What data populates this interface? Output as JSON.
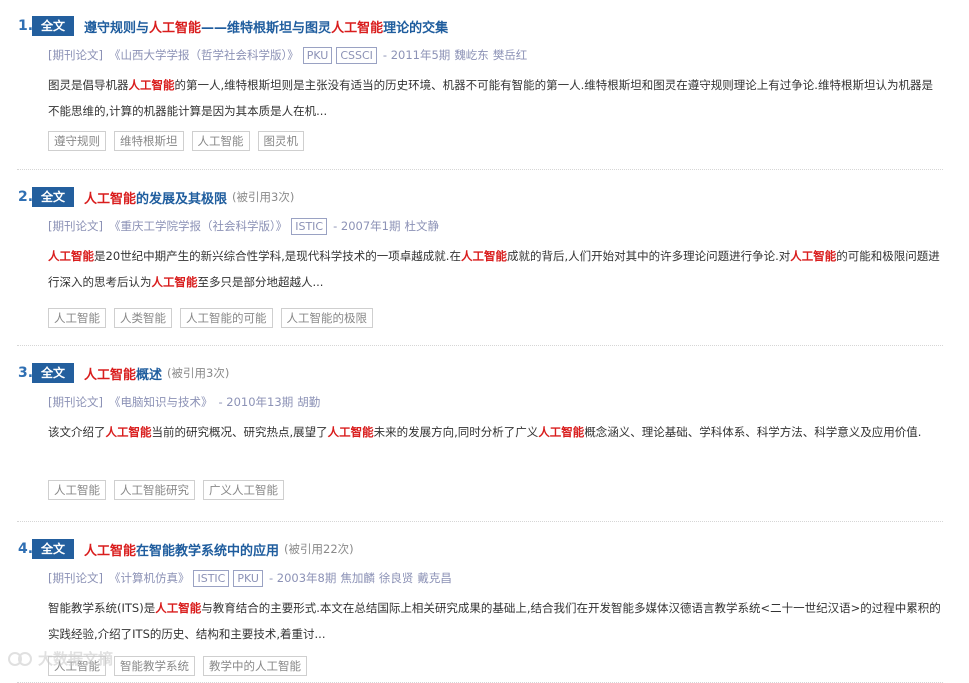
{
  "fulltext_label": "全文",
  "results": [
    {
      "num": "1.",
      "title_parts": [
        {
          "text": "遵守规则与",
          "hl": false
        },
        {
          "text": "人工智能",
          "hl": true
        },
        {
          "text": "——维特根斯坦与图灵",
          "hl": false
        },
        {
          "text": "人工智能",
          "hl": true
        },
        {
          "text": "理论的交集",
          "hl": false
        }
      ],
      "cite": "",
      "type": "[期刊论文]",
      "journal": "《山西大学学报（哲学社会科学版）》",
      "badges": [
        "PKU",
        "CSSCI"
      ],
      "issue": "- 2011年5期",
      "authors": [
        "魏屹东",
        "樊岳红"
      ],
      "snippet_parts": [
        {
          "text": "图灵是倡导机器",
          "hl": false
        },
        {
          "text": "人工智能",
          "hl": true
        },
        {
          "text": "的第一人,维特根斯坦则是主张没有适当的历史环境、机器不可能有智能的第一人.维特根斯坦和图灵在遵守规则理论上有过争论.维特根斯坦认为机器是不能思维的,计算的机器能计算是因为其本质是人在机...",
          "hl": false
        }
      ],
      "tags": [
        "遵守规则",
        "维特根斯坦",
        "人工智能",
        "图灵机"
      ]
    },
    {
      "num": "2.",
      "title_parts": [
        {
          "text": "人工智能",
          "hl": true
        },
        {
          "text": "的发展及其极限",
          "hl": false
        }
      ],
      "cite": "(被引用3次)",
      "type": "[期刊论文]",
      "journal": "《重庆工学院学报（社会科学版）》",
      "badges": [
        "ISTIC"
      ],
      "issue": "- 2007年1期",
      "authors": [
        "杜文静"
      ],
      "snippet_parts": [
        {
          "text": "人工智能",
          "hl": true
        },
        {
          "text": "是20世纪中期产生的新兴综合性学科,是现代科学技术的一项卓越成就.在",
          "hl": false
        },
        {
          "text": "人工智能",
          "hl": true
        },
        {
          "text": "成就的背后,人们开始对其中的许多理论问题进行争论.对",
          "hl": false
        },
        {
          "text": "人工智能",
          "hl": true
        },
        {
          "text": "的可能和极限问题进行深入的思考后认为",
          "hl": false
        },
        {
          "text": "人工智能",
          "hl": true
        },
        {
          "text": "至多只是部分地超越人...",
          "hl": false
        }
      ],
      "tags": [
        "人工智能",
        "人类智能",
        "人工智能的可能",
        "人工智能的极限"
      ]
    },
    {
      "num": "3.",
      "title_parts": [
        {
          "text": "人工智能",
          "hl": true
        },
        {
          "text": "概述",
          "hl": false
        }
      ],
      "cite": "(被引用3次)",
      "type": "[期刊论文]",
      "journal": "《电脑知识与技术》",
      "badges": [],
      "issue": "- 2010年13期",
      "authors": [
        "胡勤"
      ],
      "snippet_parts": [
        {
          "text": "该文介绍了",
          "hl": false
        },
        {
          "text": "人工智能",
          "hl": true
        },
        {
          "text": "当前的研究概况、研究热点,展望了",
          "hl": false
        },
        {
          "text": "人工智能",
          "hl": true
        },
        {
          "text": "未来的发展方向,同时分析了广义",
          "hl": false
        },
        {
          "text": "人工智能",
          "hl": true
        },
        {
          "text": "概念涵义、理论基础、学科体系、科学方法、科学意义及应用价值.",
          "hl": false
        }
      ],
      "tags": [
        "人工智能",
        "人工智能研究",
        "广义人工智能"
      ]
    },
    {
      "num": "4.",
      "title_parts": [
        {
          "text": "人工智能",
          "hl": true
        },
        {
          "text": "在智能教学系统中的应用",
          "hl": false
        }
      ],
      "cite": "(被引用22次)",
      "type": "[期刊论文]",
      "journal": "《计算机仿真》",
      "badges": [
        "ISTIC",
        "PKU"
      ],
      "issue": "- 2003年8期",
      "authors": [
        "焦加麟",
        "徐良贤",
        "戴克昌"
      ],
      "snippet_parts": [
        {
          "text": "智能教学系统(ITS)是",
          "hl": false
        },
        {
          "text": "人工智能",
          "hl": true
        },
        {
          "text": "与教育结合的主要形式.本文在总结国际上相关研究成果的基础上,结合我们在开发智能多媒体汉德语言教学系统<二十一世纪汉语>的过程中累积的实践经验,介绍了ITS的历史、结构和主要技术,着重讨...",
          "hl": false
        }
      ],
      "tags": [
        "人工智能",
        "智能教学系统",
        "教学中的人工智能"
      ]
    }
  ],
  "watermark": "大数据文摘"
}
